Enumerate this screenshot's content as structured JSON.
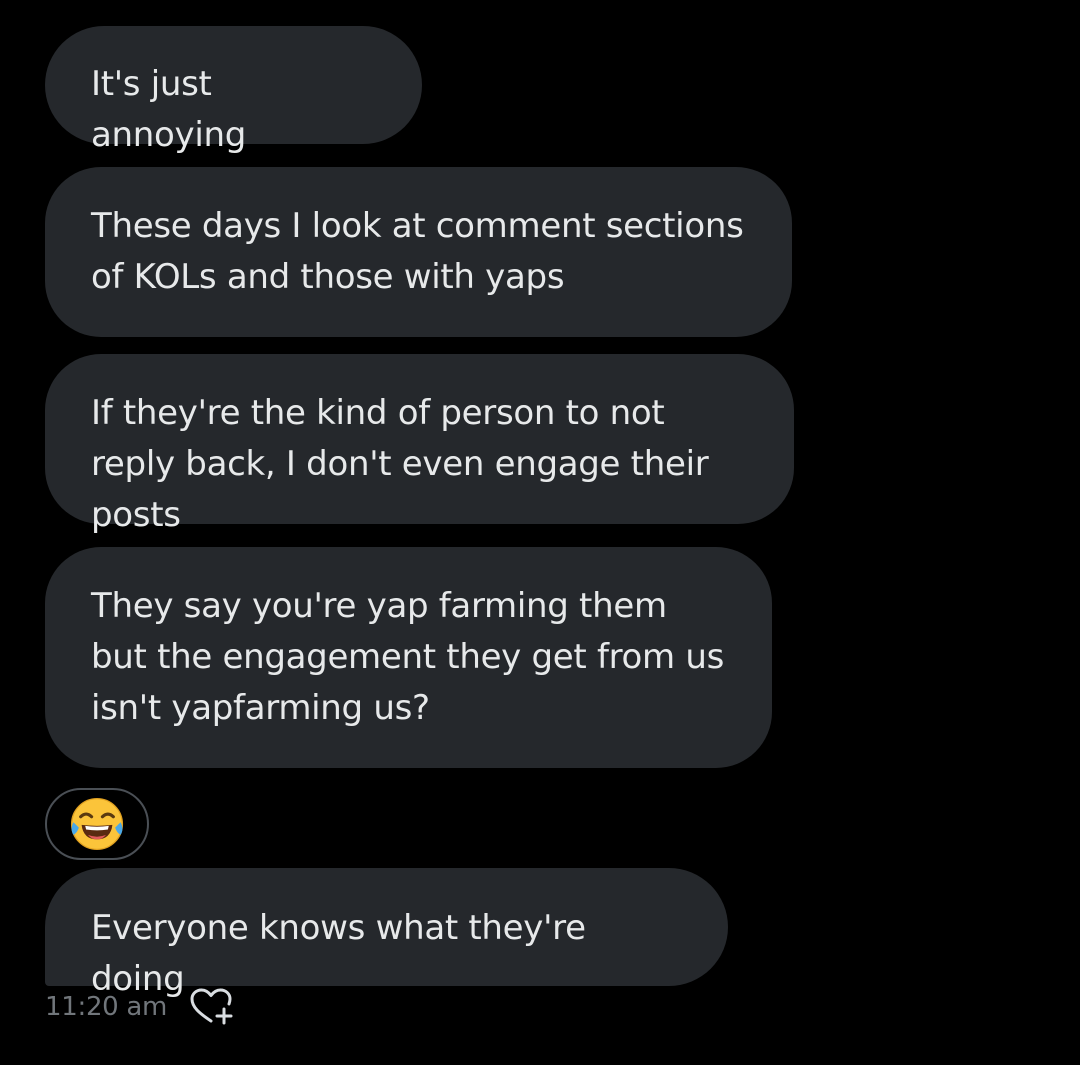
{
  "conversation": {
    "messages": [
      {
        "text": "It's just annoying"
      },
      {
        "text": "These days I look at comment sections of KOLs and those with yaps"
      },
      {
        "text": "If they're the kind of person to not reply back, I don't even engage their posts"
      },
      {
        "text": "They say you're yap farming them but the engagement they get from us isn't yapfarming us?"
      },
      {
        "reaction_only": true,
        "emoji": "😂",
        "icon": "face-with-tears-of-joy-icon"
      },
      {
        "text": "Everyone knows what they're doing"
      }
    ],
    "timestamp": "11:20 am",
    "reaction_action_icon": "heart-plus-icon"
  },
  "colors": {
    "background": "#000000",
    "bubble": "#25282c",
    "text": "#e7e9ea",
    "muted": "#71767b",
    "reaction_border": "#4a4f55"
  }
}
